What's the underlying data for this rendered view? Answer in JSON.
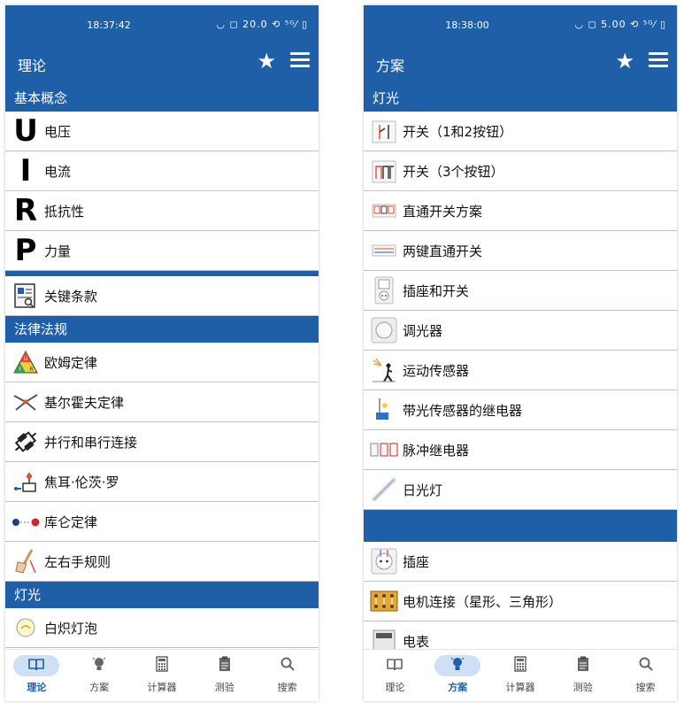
{
  "left": {
    "status": {
      "time": "18:37:42",
      "icons": "◡ ◻ 20.0 ⟲ ⁵ᴳ⁄ ▯"
    },
    "appbar": {
      "title": "理论"
    },
    "sections": {
      "s1": "基本概念",
      "s2": "法律法规",
      "s3": "灯光"
    },
    "basic": {
      "u_letter": "U",
      "u_label": "电压",
      "i_letter": "I",
      "i_label": "电流",
      "r_letter": "R",
      "r_label": "抵抗性",
      "p_letter": "P",
      "p_label": "力量",
      "terms_label": "关键条款"
    },
    "laws": [
      "欧姆定律",
      "基尔霍夫定律",
      "并行和串行连接",
      "焦耳·伦茨·罗",
      "库仑定律",
      "左右手规则"
    ],
    "light": {
      "bulb_label": "白炽灯泡"
    },
    "nav": {
      "theory": "理论",
      "plans": "方案",
      "calc": "计算器",
      "test": "测验",
      "search": "搜索"
    }
  },
  "right": {
    "status": {
      "time": "18:38:00",
      "icons": "◡ ◻ 5.00 ⟲ ⁵ᴳ⁄ ▯"
    },
    "appbar": {
      "title": "方案"
    },
    "sections": {
      "s1": "灯光",
      "s2": ""
    },
    "light_items": [
      "开关（1和2按钮）",
      "开关（3个按钮）",
      "直通开关方案",
      "两键直通开关",
      "插座和开关",
      "调光器",
      "运动传感器",
      "带光传感器的继电器",
      "脉冲继电器",
      "日光灯"
    ],
    "socket_items": [
      "插座",
      "电机连接（星形、三角形）",
      "电表"
    ],
    "nav": {
      "theory": "理论",
      "plans": "方案",
      "calc": "计算器",
      "test": "测验",
      "search": "搜索"
    }
  },
  "colors": {
    "primary": "#1f5fa8",
    "active_pill": "#cfe0f4",
    "divider": "#b7c5d6"
  },
  "icons": {
    "nav": [
      "book-icon",
      "bulb-icon",
      "calculator-icon",
      "clipboard-icon",
      "search-icon"
    ]
  }
}
